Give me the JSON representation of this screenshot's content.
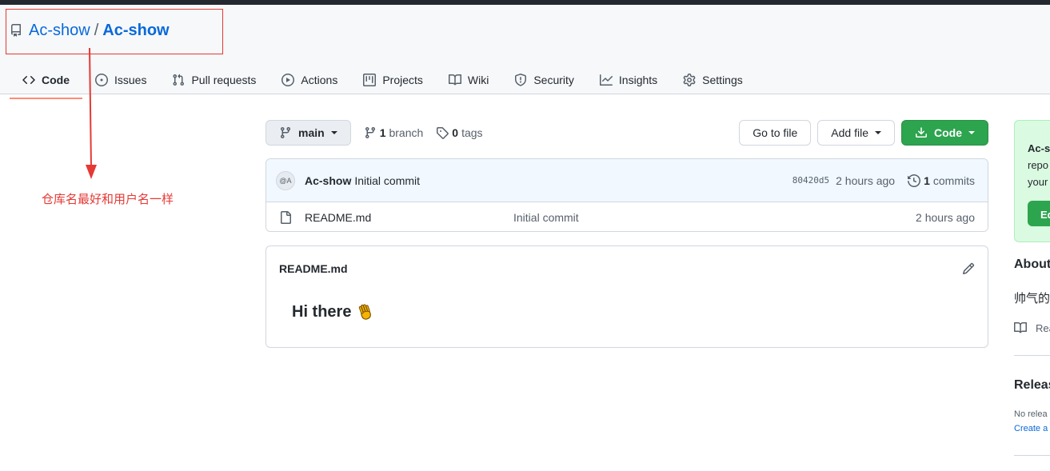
{
  "repo": {
    "owner": "Ac-show",
    "separator": "/",
    "name": "Ac-show"
  },
  "annotation": {
    "text": "仓库名最好和用户名一样",
    "color": "#e53935"
  },
  "tabs": [
    {
      "label": "Code",
      "icon": "code-icon",
      "active": true
    },
    {
      "label": "Issues",
      "icon": "issue-icon"
    },
    {
      "label": "Pull requests",
      "icon": "pull-request-icon"
    },
    {
      "label": "Actions",
      "icon": "play-icon"
    },
    {
      "label": "Projects",
      "icon": "project-icon"
    },
    {
      "label": "Wiki",
      "icon": "book-icon"
    },
    {
      "label": "Security",
      "icon": "shield-icon"
    },
    {
      "label": "Insights",
      "icon": "graph-icon"
    },
    {
      "label": "Settings",
      "icon": "gear-icon"
    }
  ],
  "branch_bar": {
    "branch": "main",
    "branch_count": "1",
    "branch_label": "branch",
    "tag_count": "0",
    "tag_label": "tags",
    "go_to_file": "Go to file",
    "add_file": "Add file",
    "code": "Code"
  },
  "commit": {
    "author": "Ac-show",
    "message": "Initial commit",
    "avatar_alt": "@A",
    "sha": "80420d5",
    "time": "2 hours ago",
    "commit_count": "1",
    "commit_label": "commits"
  },
  "files": [
    {
      "name": "README.md",
      "commit": "Initial commit",
      "time": "2 hours ago",
      "icon": "file-icon"
    }
  ],
  "readme": {
    "title": "README.md",
    "heading": "Hi there",
    "emoji": "waving-hand-icon"
  },
  "sidebar": {
    "promo_title": "Ac-s",
    "promo_line2": "repo",
    "promo_line3": "your",
    "promo_button": "Ed",
    "about_heading": "About",
    "about_desc": "帅气的",
    "readme_link": "Rea",
    "releases_heading": "Releas",
    "releases_desc": "No relea",
    "releases_link": "Create a"
  },
  "colors": {
    "accent": "#0969da",
    "green": "#2da44e",
    "tab_underline": "#fd8c73"
  }
}
